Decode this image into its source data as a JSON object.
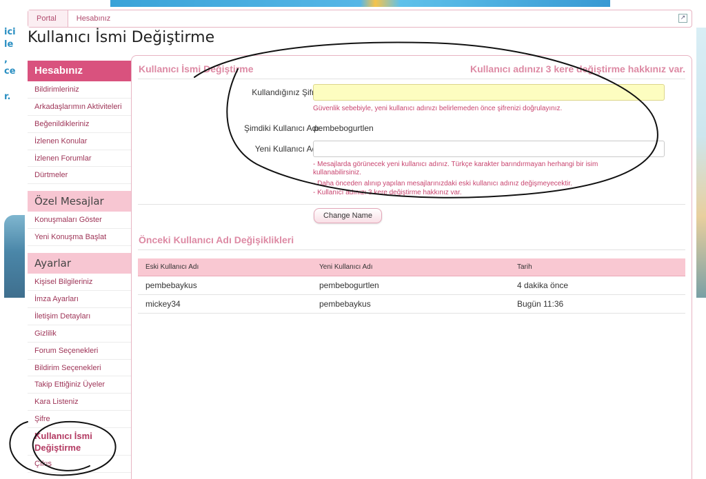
{
  "breadcrumb": {
    "items": [
      "Portal",
      "Hesabınız"
    ]
  },
  "page_title": "Kullanıcı İsmi Değiştirme",
  "left_strip": [
    "ici",
    "le",
    ",",
    "ce",
    "r."
  ],
  "sidebar": {
    "sections": [
      {
        "header": "Hesabınız",
        "items": [
          "Bildirimleriniz",
          "Arkadaşlarımın Aktiviteleri",
          "Beğenildikleriniz",
          "İzlenen Konular",
          "İzlenen Forumlar",
          "Dürtmeler"
        ]
      },
      {
        "header": "Özel Mesajlar",
        "items": [
          "Konuşmaları Göster",
          "Yeni Konuşma Başlat"
        ]
      },
      {
        "header": "Ayarlar",
        "items": [
          "Kişisel Bilgileriniz",
          "İmza Ayarları",
          "İletişim Detayları",
          "Gizlilik",
          "Forum Seçenekleri",
          "Bildirim Seçenekleri",
          "Takip Ettiğiniz Üyeler",
          "Kara Listeniz",
          "Şifre"
        ],
        "active": "Kullanıcı İsmi Değiştirme",
        "after": "Çıkış"
      }
    ]
  },
  "form": {
    "title": "Kullanıcı İsmi Değiştirme",
    "note": "Kullanıcı adınızı 3 kere değiştirme hakkınız var.",
    "password_label": "Kullandığınız Şifre:",
    "password_value": "",
    "password_hint": "Güvenlik sebebiyle, yeni kullanıcı adınızı belirlemeden önce şifrenizi doğrulayınız.",
    "current_label": "Şimdiki Kullanıcı Adı:",
    "current_value": "pembebogurtlen",
    "new_label": "Yeni Kullanıcı Adı:",
    "new_value": "",
    "hints": [
      "- Mesajlarda görünecek yeni kullanıcı adınız. Türkçe karakter barındırmayan herhangi bir isim kullanabilirsiniz.",
      "- Daha önceden alınıp yapılan mesajlarınızdaki eski kullanıcı adınız değişmeyecektir.",
      "- Kullanıcı adınızı 3 kere değiştirme hakkınız var."
    ],
    "submit_label": "Change Name"
  },
  "history": {
    "title": "Önceki Kullanıcı Adı Değişiklikleri",
    "columns": [
      "Eski Kullanıcı Adı",
      "Yeni Kullanıcı Adı",
      "Tarih"
    ],
    "rows": [
      [
        "pembebaykus",
        "pembebogurtlen",
        "4 dakika önce"
      ],
      [
        "mickey34",
        "pembebaykus",
        "Bugün 11:36"
      ]
    ]
  },
  "colors": {
    "accent": "#d9527e",
    "accent_light": "#f7c6d2",
    "link": "#9e3457",
    "hint": "#c8456f"
  }
}
